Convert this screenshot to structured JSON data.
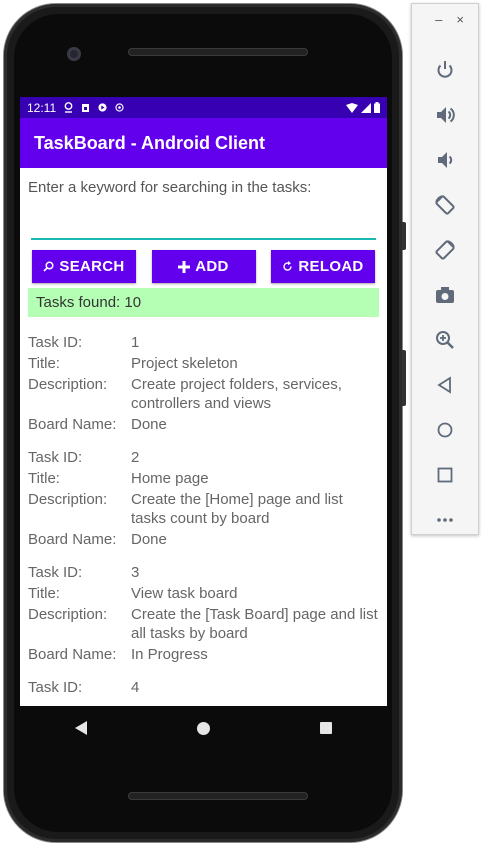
{
  "status_bar": {
    "time": "12:11"
  },
  "app_bar": {
    "title": "TaskBoard - Android Client"
  },
  "search": {
    "prompt": "Enter a keyword for searching in the tasks:",
    "value": "",
    "placeholder": ""
  },
  "buttons": {
    "search": "SEARCH",
    "add": "ADD",
    "reload": "RELOAD"
  },
  "summary": {
    "found_text": "Tasks found: 10"
  },
  "field_labels": {
    "id": "Task ID:",
    "title": "Title:",
    "description": "Description:",
    "board": "Board Name:"
  },
  "tasks": [
    {
      "id": "1",
      "title": "Project skeleton",
      "description": "Create project folders, services, controllers and views",
      "board": "Done"
    },
    {
      "id": "2",
      "title": "Home page",
      "description": "Create the [Home] page and list tasks count by board",
      "board": "Done"
    },
    {
      "id": "3",
      "title": "View task board",
      "description": "Create the [Task Board] page and list all tasks by board",
      "board": "In Progress"
    },
    {
      "id": "4"
    }
  ],
  "toolbar": {
    "minimize": "–",
    "close": "×",
    "icons": [
      "power-icon",
      "volume-up-icon",
      "volume-down-icon",
      "rotate-left-icon",
      "rotate-right-icon",
      "camera-icon",
      "zoom-icon",
      "back-icon",
      "home-icon",
      "overview-icon",
      "more-icon"
    ]
  },
  "colors": {
    "primary": "#6200ee",
    "primary_dark": "#3700b3",
    "found_bg": "#b5ffb5",
    "input_line": "#18b9b0"
  }
}
